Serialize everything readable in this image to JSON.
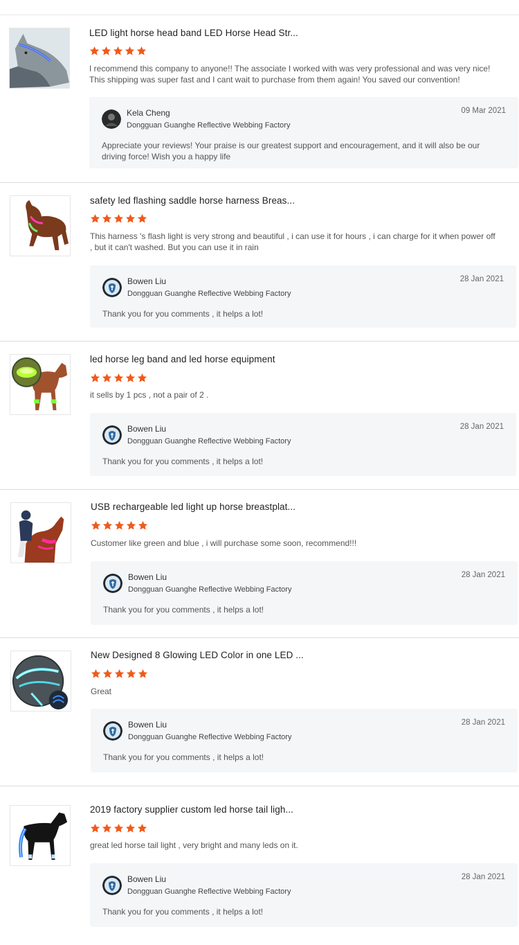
{
  "colors": {
    "star": "#f05a1a",
    "reply_bg": "#f5f6f8",
    "divider": "#dcdcdc"
  },
  "reviews": [
    {
      "title": "LED light horse head band LED Horse Head Str...",
      "rating": 5,
      "text": "I recommend this company to anyone!! The associate I worked with was very professional and was very nice! This shipping was super fast and I cant wait to purchase from them again! You saved our convention!",
      "reply": {
        "name": "Kela Cheng",
        "company": "Dongguan Guanghe Reflective Webbing Factory",
        "date": "09 Mar 2021",
        "text": "Appreciate your reviews! Your praise is our greatest support and encouragement, and it will also be our driving force! Wish you a happy life"
      }
    },
    {
      "title": "safety led flashing saddle horse harness Breas...",
      "rating": 5,
      "text": "This harness 's flash light is very strong and beautiful , i can use it for hours , i can charge for it when power off , but it can't washed. But you can use it in rain",
      "reply": {
        "name": "Bowen Liu",
        "company": "Dongguan Guanghe Reflective Webbing Factory",
        "date": "28 Jan 2021",
        "text": "Thank you for you comments , it helps a lot!"
      }
    },
    {
      "title": "led horse leg band and led horse equipment",
      "rating": 5,
      "text": "it sells by 1 pcs , not a pair of 2 .",
      "reply": {
        "name": "Bowen Liu",
        "company": "Dongguan Guanghe Reflective Webbing Factory",
        "date": "28 Jan 2021",
        "text": "Thank you for you comments , it helps a lot!"
      }
    },
    {
      "title": "USB rechargeable led light up horse breastplat...",
      "rating": 5,
      "text": "Customer like green and blue , i will purchase some soon, recommend!!!",
      "reply": {
        "name": "Bowen Liu",
        "company": "Dongguan Guanghe Reflective Webbing Factory",
        "date": "28 Jan 2021",
        "text": "Thank you for you comments , it helps a lot!"
      }
    },
    {
      "title": "New Designed 8 Glowing LED Color in one LED ...",
      "rating": 5,
      "text": "Great",
      "reply": {
        "name": "Bowen Liu",
        "company": "Dongguan Guanghe Reflective Webbing Factory",
        "date": "28 Jan 2021",
        "text": "Thank you for you comments , it helps a lot!"
      }
    },
    {
      "title": "2019 factory supplier custom led horse tail ligh...",
      "rating": 5,
      "text": "great led horse tail light , very bright and many leds on it.",
      "reply": {
        "name": "Bowen Liu",
        "company": "Dongguan Guanghe Reflective Webbing Factory",
        "date": "28 Jan 2021",
        "text": "Thank you for you comments , it helps a lot!"
      }
    }
  ]
}
